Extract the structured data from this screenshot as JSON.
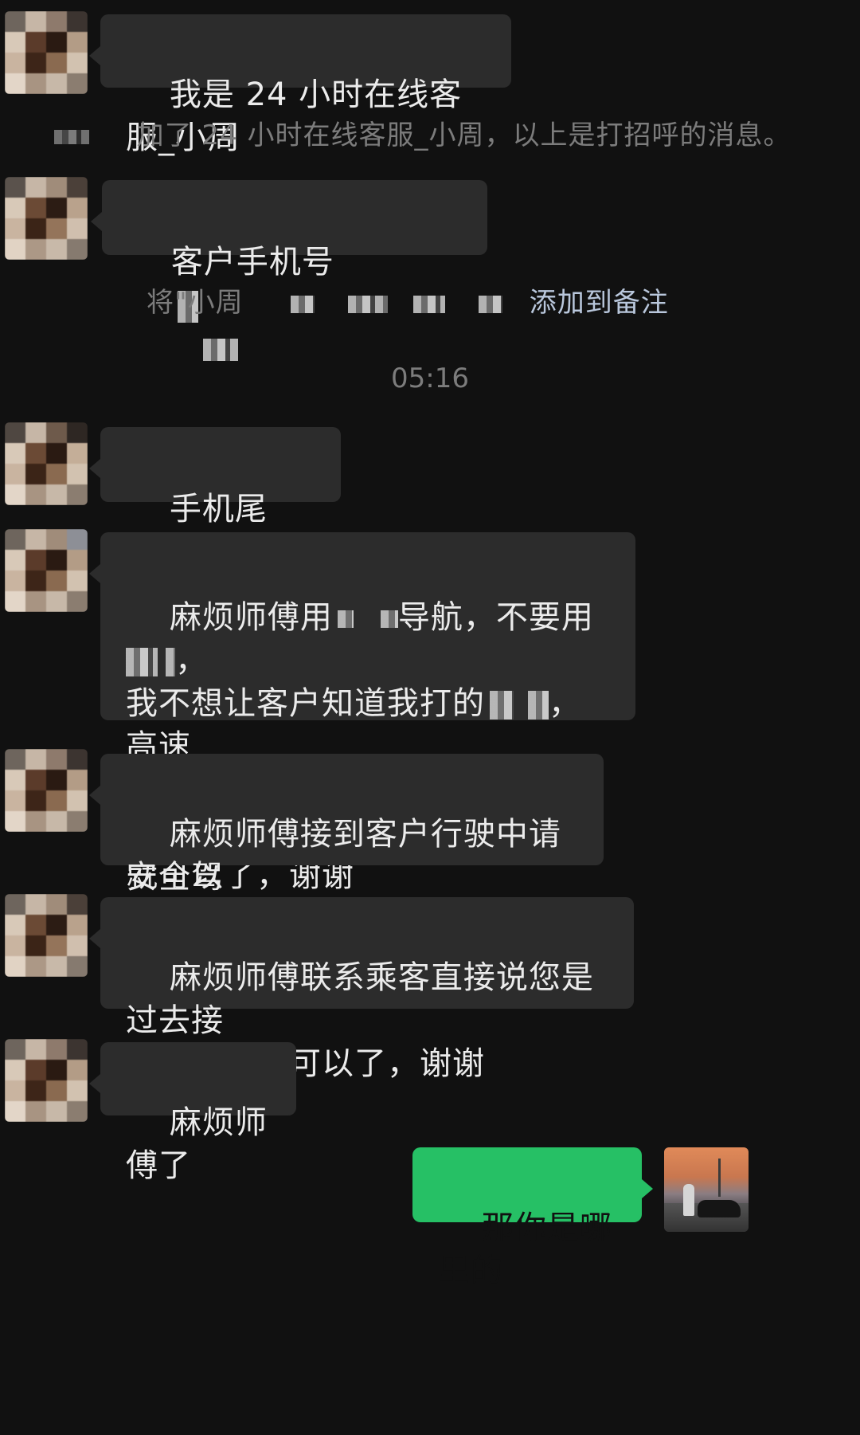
{
  "messages": [
    {
      "text": "我是 24 小时在线客服_小周"
    },
    {
      "text": "客户手机号"
    },
    {
      "text": "手机尾"
    },
    {
      "text": "麻烦师傅用",
      "text2": "导航，不要用",
      "text3": "，\n我不想让客户知道我打的",
      "text4": "，高速\n费我这边付，等下添加上去，我支付\n就可以了，谢谢"
    },
    {
      "text": "麻烦师傅接到客户行驶中请安全驾\n驶，不要接打电话、玩手机"
    },
    {
      "text": "麻烦师傅联系乘客直接说您是过去接\n他的司机就可以了，谢谢"
    },
    {
      "text": "麻烦师傅了"
    },
    {
      "text": "那你是哪里的"
    }
  ],
  "system": {
    "added_notice": "加了 24 小时在线客服_小周，以上是打招呼的消息。",
    "remark_prefix": "将\"小周",
    "remark_link": "添加到备注",
    "timestamp": "05:16"
  },
  "colors": {
    "background": "#111111",
    "incoming_bubble": "#2c2c2c",
    "outgoing_bubble": "#26c065",
    "system_text": "#7c7c7c"
  }
}
